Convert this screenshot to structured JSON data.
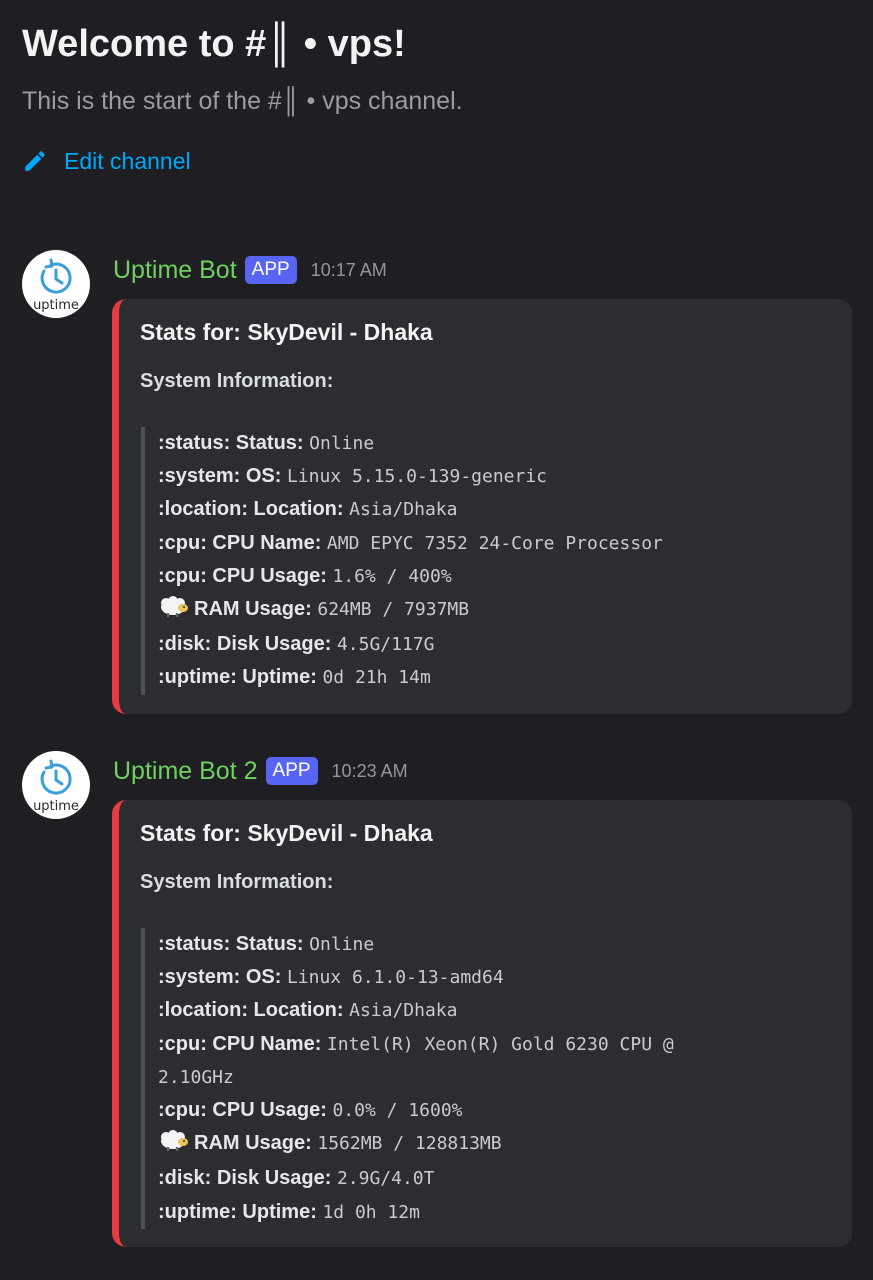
{
  "channel": {
    "welcome_title": "Welcome to #║ • vps!",
    "welcome_subtitle": "This is the start of the #║ • vps channel.",
    "edit_label": "Edit channel"
  },
  "colors": {
    "background": "#1f1f23",
    "author": "#6fd05f",
    "app_badge": "#5865f2",
    "embed_accent": "#e83b3f",
    "link": "#00a8fc"
  },
  "messages": [
    {
      "avatar_text": "uptime",
      "author": "Uptime Bot",
      "badge": "APP",
      "time": "10:17 AM",
      "embed": {
        "title": "Stats for: SkyDevil - Dhaka",
        "field_name": "System Information:",
        "rows": [
          {
            "label": ":status: Status:",
            "value": "Online"
          },
          {
            "label": ":system: OS:",
            "value": "Linux 5.15.0-139-generic"
          },
          {
            "label": ":location: Location:",
            "value": "Asia/Dhaka"
          },
          {
            "label": ":cpu: CPU Name:",
            "value": "AMD EPYC 7352 24-Core Processor"
          },
          {
            "label": ":cpu: CPU Usage:",
            "value": "1.6% / 400%"
          },
          {
            "label": "RAM Usage:",
            "value": "624MB / 7937MB",
            "icon": "ram-sheep-emoji"
          },
          {
            "label": ":disk: Disk Usage:",
            "value": "4.5G/117G"
          },
          {
            "label": ":uptime: Uptime:",
            "value": "0d 21h 14m"
          }
        ]
      }
    },
    {
      "avatar_text": "uptime",
      "author": "Uptime Bot 2",
      "badge": "APP",
      "time": "10:23 AM",
      "embed": {
        "title": "Stats for: SkyDevil - Dhaka",
        "field_name": "System Information:",
        "rows": [
          {
            "label": ":status: Status:",
            "value": "Online"
          },
          {
            "label": ":system: OS:",
            "value": "Linux 6.1.0-13-amd64"
          },
          {
            "label": ":location: Location:",
            "value": "Asia/Dhaka"
          },
          {
            "label": ":cpu: CPU Name:",
            "value": "Intel(R) Xeon(R) Gold 6230 CPU @",
            "continuation": "2.10GHz"
          },
          {
            "label": ":cpu: CPU Usage:",
            "value": "0.0% / 1600%"
          },
          {
            "label": "RAM Usage:",
            "value": "1562MB / 128813MB",
            "icon": "ram-sheep-emoji"
          },
          {
            "label": ":disk: Disk Usage:",
            "value": "2.9G/4.0T"
          },
          {
            "label": ":uptime: Uptime:",
            "value": "1d 0h 12m"
          }
        ]
      }
    }
  ]
}
